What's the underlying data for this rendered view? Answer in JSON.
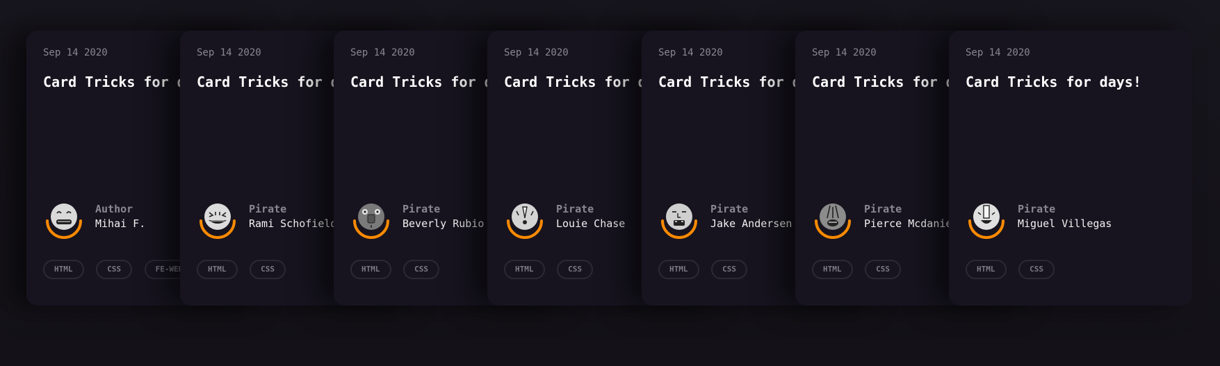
{
  "cards": [
    {
      "date": "Sep 14 2020",
      "title": "Card Tricks for days!",
      "role": "Author",
      "name": "Mihai F.",
      "tags": [
        "HTML",
        "CSS",
        "FE-WEB-DEV"
      ],
      "face": "happy"
    },
    {
      "date": "Sep 14 2020",
      "title": "Card Tricks for days!",
      "role": "Pirate",
      "name": "Rami Schofield",
      "tags": [
        "HTML",
        "CSS"
      ],
      "face": "grin"
    },
    {
      "date": "Sep 14 2020",
      "title": "Card Tricks for days!",
      "role": "Pirate",
      "name": "Beverly Rubio",
      "tags": [
        "HTML",
        "CSS"
      ],
      "face": "dark"
    },
    {
      "date": "Sep 14 2020",
      "title": "Card Tricks for days!",
      "role": "Pirate",
      "name": "Louie Chase",
      "tags": [
        "HTML",
        "CSS"
      ],
      "face": "long"
    },
    {
      "date": "Sep 14 2020",
      "title": "Card Tricks for days!",
      "role": "Pirate",
      "name": "Jake Andersen",
      "tags": [
        "HTML",
        "CSS"
      ],
      "face": "square"
    },
    {
      "date": "Sep 14 2020",
      "title": "Card Tricks for days!",
      "role": "Pirate",
      "name": "Pierce Mcdaniel",
      "tags": [
        "HTML",
        "CSS"
      ],
      "face": "grey"
    },
    {
      "date": "Sep 14 2020",
      "title": "Card Tricks for days!",
      "role": "Pirate",
      "name": "Miguel Villegas",
      "tags": [
        "HTML",
        "CSS"
      ],
      "face": "open"
    }
  ],
  "colors": {
    "background": "#16141c",
    "card": "#17141f",
    "accent": "#ff8a00",
    "muted": "#8a8794",
    "tag_border": "#2c2935"
  }
}
